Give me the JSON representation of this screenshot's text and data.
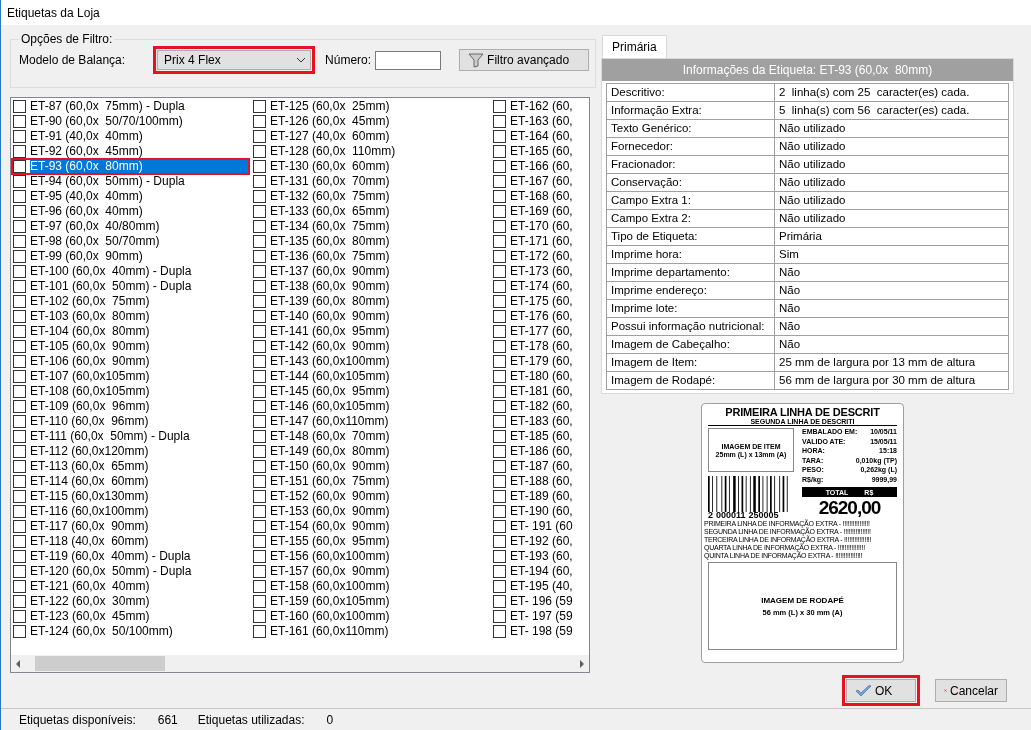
{
  "window": {
    "title": "Etiquetas da Loja"
  },
  "filter": {
    "legend": "Opções de Filtro:",
    "model_label": "Modelo de Balança:",
    "model_value": "Prix 4 Flex",
    "model_highlighted": true,
    "number_label": "Número:",
    "advanced_button": "Filtro avançado"
  },
  "label_list": {
    "highlight_selected": true,
    "columns": [
      {
        "items": [
          {
            "text": "ET-87 (60,0x  75mm) - Dupla",
            "checked": false,
            "selected": false
          },
          {
            "text": "ET-90 (60,0x  50/70/100mm)",
            "checked": false,
            "selected": false
          },
          {
            "text": "ET-91 (40,0x  40mm)",
            "checked": false,
            "selected": false
          },
          {
            "text": "ET-92 (60,0x  45mm)",
            "checked": false,
            "selected": false
          },
          {
            "text": "ET-93 (60,0x  80mm)",
            "checked": false,
            "selected": true
          },
          {
            "text": "ET-94 (60,0x  50mm) - Dupla",
            "checked": false,
            "selected": false
          },
          {
            "text": "ET-95 (40,0x  40mm)",
            "checked": false,
            "selected": false
          },
          {
            "text": "ET-96 (60,0x  40mm)",
            "checked": false,
            "selected": false
          },
          {
            "text": "ET-97 (60,0x  40/80mm)",
            "checked": false,
            "selected": false
          },
          {
            "text": "ET-98 (60,0x  50/70mm)",
            "checked": false,
            "selected": false
          },
          {
            "text": "ET-99 (60,0x  90mm)",
            "checked": false,
            "selected": false
          },
          {
            "text": "ET-100 (60,0x  40mm) - Dupla",
            "checked": false,
            "selected": false
          },
          {
            "text": "ET-101 (60,0x  50mm) - Dupla",
            "checked": false,
            "selected": false
          },
          {
            "text": "ET-102 (60,0x  75mm)",
            "checked": false,
            "selected": false
          },
          {
            "text": "ET-103 (60,0x  80mm)",
            "checked": false,
            "selected": false
          },
          {
            "text": "ET-104 (60,0x  80mm)",
            "checked": false,
            "selected": false
          },
          {
            "text": "ET-105 (60,0x  90mm)",
            "checked": false,
            "selected": false
          },
          {
            "text": "ET-106 (60,0x  90mm)",
            "checked": false,
            "selected": false
          },
          {
            "text": "ET-107 (60,0x105mm)",
            "checked": false,
            "selected": false
          },
          {
            "text": "ET-108 (60,0x105mm)",
            "checked": false,
            "selected": false
          },
          {
            "text": "ET-109 (60,0x  96mm)",
            "checked": false,
            "selected": false
          },
          {
            "text": "ET-110 (60,0x  96mm)",
            "checked": false,
            "selected": false
          },
          {
            "text": "ET-111 (60,0x  50mm) - Dupla",
            "checked": false,
            "selected": false
          },
          {
            "text": "ET-112 (60,0x120mm)",
            "checked": false,
            "selected": false
          },
          {
            "text": "ET-113 (60,0x  65mm)",
            "checked": false,
            "selected": false
          },
          {
            "text": "ET-114 (60,0x  60mm)",
            "checked": false,
            "selected": false
          },
          {
            "text": "ET-115 (60,0x130mm)",
            "checked": false,
            "selected": false
          },
          {
            "text": "ET-116 (60,0x100mm)",
            "checked": false,
            "selected": false
          },
          {
            "text": "ET-117 (60,0x  90mm)",
            "checked": false,
            "selected": false
          },
          {
            "text": "ET-118 (40,0x  60mm)",
            "checked": false,
            "selected": false
          },
          {
            "text": "ET-119 (60,0x  40mm) - Dupla",
            "checked": false,
            "selected": false
          },
          {
            "text": "ET-120 (60,0x  50mm) - Dupla",
            "checked": false,
            "selected": false
          },
          {
            "text": "ET-121 (60,0x  40mm)",
            "checked": false,
            "selected": false
          },
          {
            "text": "ET-122 (60,0x  30mm)",
            "checked": false,
            "selected": false
          },
          {
            "text": "ET-123 (60,0x  45mm)",
            "checked": false,
            "selected": false
          },
          {
            "text": "ET-124 (60,0x  50/100mm)",
            "checked": false,
            "selected": false
          }
        ]
      },
      {
        "items": [
          {
            "text": "ET-125 (60,0x  25mm)",
            "checked": false,
            "selected": false
          },
          {
            "text": "ET-126 (60,0x  45mm)",
            "checked": false,
            "selected": false
          },
          {
            "text": "ET-127 (40,0x  60mm)",
            "checked": false,
            "selected": false
          },
          {
            "text": "ET-128 (60,0x  110mm)",
            "checked": false,
            "selected": false
          },
          {
            "text": "ET-130 (60,0x  60mm)",
            "checked": false,
            "selected": false
          },
          {
            "text": "ET-131 (60,0x  70mm)",
            "checked": false,
            "selected": false
          },
          {
            "text": "ET-132 (60,0x  75mm)",
            "checked": false,
            "selected": false
          },
          {
            "text": "ET-133 (60,0x  65mm)",
            "checked": false,
            "selected": false
          },
          {
            "text": "ET-134 (60,0x  75mm)",
            "checked": false,
            "selected": false
          },
          {
            "text": "ET-135 (60,0x  80mm)",
            "checked": false,
            "selected": false
          },
          {
            "text": "ET-136 (60,0x  75mm)",
            "checked": false,
            "selected": false
          },
          {
            "text": "ET-137 (60,0x  90mm)",
            "checked": false,
            "selected": false
          },
          {
            "text": "ET-138 (60,0x  90mm)",
            "checked": false,
            "selected": false
          },
          {
            "text": "ET-139 (60,0x  80mm)",
            "checked": false,
            "selected": false
          },
          {
            "text": "ET-140 (60,0x  90mm)",
            "checked": false,
            "selected": false
          },
          {
            "text": "ET-141 (60,0x  95mm)",
            "checked": false,
            "selected": false
          },
          {
            "text": "ET-142 (60,0x  90mm)",
            "checked": false,
            "selected": false
          },
          {
            "text": "ET-143 (60,0x100mm)",
            "checked": false,
            "selected": false
          },
          {
            "text": "ET-144 (60,0x105mm)",
            "checked": false,
            "selected": false
          },
          {
            "text": "ET-145 (60,0x  95mm)",
            "checked": false,
            "selected": false
          },
          {
            "text": "ET-146 (60,0x105mm)",
            "checked": false,
            "selected": false
          },
          {
            "text": "ET-147 (60,0x110mm)",
            "checked": false,
            "selected": false
          },
          {
            "text": "ET-148 (60,0x  70mm)",
            "checked": false,
            "selected": false
          },
          {
            "text": "ET-149 (60,0x  80mm)",
            "checked": false,
            "selected": false
          },
          {
            "text": "ET-150 (60,0x  90mm)",
            "checked": false,
            "selected": false
          },
          {
            "text": "ET-151 (60,0x  75mm)",
            "checked": false,
            "selected": false
          },
          {
            "text": "ET-152 (60,0x  90mm)",
            "checked": false,
            "selected": false
          },
          {
            "text": "ET-153 (60,0x  90mm)",
            "checked": false,
            "selected": false
          },
          {
            "text": "ET-154 (60,0x  90mm)",
            "checked": false,
            "selected": false
          },
          {
            "text": "ET-155 (60,0x  95mm)",
            "checked": false,
            "selected": false
          },
          {
            "text": "ET-156 (60,0x100mm)",
            "checked": false,
            "selected": false
          },
          {
            "text": "ET-157 (60,0x  90mm)",
            "checked": false,
            "selected": false
          },
          {
            "text": "ET-158 (60,0x100mm)",
            "checked": false,
            "selected": false
          },
          {
            "text": "ET-159 (60,0x105mm)",
            "checked": false,
            "selected": false
          },
          {
            "text": "ET-160 (60,0x100mm)",
            "checked": false,
            "selected": false
          },
          {
            "text": "ET-161 (60,0x110mm)",
            "checked": false,
            "selected": false
          }
        ]
      },
      {
        "items": [
          {
            "text": "ET-162 (60,",
            "checked": false,
            "selected": false
          },
          {
            "text": "ET-163 (60,",
            "checked": false,
            "selected": false
          },
          {
            "text": "ET-164 (60,",
            "checked": false,
            "selected": false
          },
          {
            "text": "ET-165 (60,",
            "checked": false,
            "selected": false
          },
          {
            "text": "ET-166 (60,",
            "checked": false,
            "selected": false
          },
          {
            "text": "ET-167 (60,",
            "checked": false,
            "selected": false
          },
          {
            "text": "ET-168 (60,",
            "checked": false,
            "selected": false
          },
          {
            "text": "ET-169 (60,",
            "checked": false,
            "selected": false
          },
          {
            "text": "ET-170 (60,",
            "checked": false,
            "selected": false
          },
          {
            "text": "ET-171 (60,",
            "checked": false,
            "selected": false
          },
          {
            "text": "ET-172 (60,",
            "checked": false,
            "selected": false
          },
          {
            "text": "ET-173 (60,",
            "checked": false,
            "selected": false
          },
          {
            "text": "ET-174 (60,",
            "checked": false,
            "selected": false
          },
          {
            "text": "ET-175 (60,",
            "checked": false,
            "selected": false
          },
          {
            "text": "ET-176 (60,",
            "checked": false,
            "selected": false
          },
          {
            "text": "ET-177 (60,",
            "checked": false,
            "selected": false
          },
          {
            "text": "ET-178 (60,",
            "checked": false,
            "selected": false
          },
          {
            "text": "ET-179 (60,",
            "checked": false,
            "selected": false
          },
          {
            "text": "ET-180 (60,",
            "checked": false,
            "selected": false
          },
          {
            "text": "ET-181 (60,",
            "checked": false,
            "selected": false
          },
          {
            "text": "ET-182 (60,",
            "checked": false,
            "selected": false
          },
          {
            "text": "ET-183 (60,",
            "checked": false,
            "selected": false
          },
          {
            "text": "ET-185 (60,",
            "checked": false,
            "selected": false
          },
          {
            "text": "ET-186 (60,",
            "checked": false,
            "selected": false
          },
          {
            "text": "ET-187 (60,",
            "checked": false,
            "selected": false
          },
          {
            "text": "ET-188 (60,",
            "checked": false,
            "selected": false
          },
          {
            "text": "ET-189 (60,",
            "checked": false,
            "selected": false
          },
          {
            "text": "ET-190 (60,",
            "checked": false,
            "selected": false
          },
          {
            "text": "ET- 191 (60",
            "checked": false,
            "selected": false
          },
          {
            "text": "ET-192 (60,",
            "checked": false,
            "selected": false
          },
          {
            "text": "ET-193 (60,",
            "checked": false,
            "selected": false
          },
          {
            "text": "ET-194 (60,",
            "checked": false,
            "selected": false
          },
          {
            "text": "ET-195 (40,",
            "checked": false,
            "selected": false
          },
          {
            "text": "ET- 196 (59",
            "checked": false,
            "selected": false
          },
          {
            "text": "ET- 197 (59",
            "checked": false,
            "selected": false
          },
          {
            "text": "ET- 198 (59",
            "checked": false,
            "selected": false
          }
        ]
      }
    ]
  },
  "tabs": [
    {
      "label": "Primária",
      "selected": true
    }
  ],
  "info": {
    "header": "Informações da Etiqueta: ET-93 (60,0x  80mm)",
    "rows": [
      {
        "label": "Descritivo:",
        "value": "2  linha(s) com 25  caracter(es) cada."
      },
      {
        "label": "Informação Extra:",
        "value": "5  linha(s) com 56  caracter(es) cada."
      },
      {
        "label": "Texto Genérico:",
        "value": "Não utilizado"
      },
      {
        "label": "Fornecedor:",
        "value": "Não utilizado"
      },
      {
        "label": "Fracionador:",
        "value": "Não utilizado"
      },
      {
        "label": "Conservação:",
        "value": "Não utilizado"
      },
      {
        "label": "Campo Extra 1:",
        "value": "Não utilizado"
      },
      {
        "label": "Campo Extra 2:",
        "value": "Não utilizado"
      },
      {
        "label": "Tipo de Etiqueta:",
        "value": "Primária"
      },
      {
        "label": "Imprime hora:",
        "value": "Sim"
      },
      {
        "label": "Imprime departamento:",
        "value": "Não"
      },
      {
        "label": "Imprime endereço:",
        "value": "Não"
      },
      {
        "label": "Imprime lote:",
        "value": "Não"
      },
      {
        "label": "Possui informação nutricional:",
        "value": "Não"
      },
      {
        "label": "Imagem de Cabeçalho:",
        "value": "Não"
      },
      {
        "label": "Imagem de Item:",
        "value": "25 mm de largura por 13 mm de altura"
      },
      {
        "label": "Imagem de Rodapé:",
        "value": "56 mm de largura por 30 mm de altura"
      }
    ]
  },
  "preview": {
    "title": "PRIMEIRA LINHA DE DESCRIT",
    "subtitle": "SEGUNDA LINHA DE DESCRITI",
    "item_image": {
      "title": "IMAGEM DE ITEM",
      "size": "25mm (L) x 13mm (A)"
    },
    "fields": [
      {
        "label": "EMBALADO EM:",
        "value": "10/05/11"
      },
      {
        "label": "VALIDO ATE:",
        "value": "15/05/11"
      },
      {
        "label": "HORA:",
        "value": "15:18"
      },
      {
        "label": "TARA:",
        "value": "0,010kg (TP)"
      },
      {
        "label": "PESO:",
        "value": "0,262kg (L)"
      },
      {
        "label": "R$/kg:",
        "value": "9999,99"
      }
    ],
    "total_label": "TOTAL",
    "total_currency": "R$",
    "total": "2620,00",
    "barcode_digits": [
      "2",
      "000011",
      "250005"
    ],
    "extra_lines": [
      "PRIMEIRA LINHA DE INFORMAÇÃO EXTRA - !!!!!!!!!!!!!!!!",
      "SEGUNDA LINHA DE INFORMAÇÃO EXTRA - !!!!!!!!!!!!!!!!",
      "TERCEIRA LINHA DE INFORMAÇÃO EXTRA - !!!!!!!!!!!!!!!!",
      "QUARTA LINHA DE INFORMAÇÃO EXTRA - !!!!!!!!!!!!!!!!",
      "QUINTA LINHA DE INFORMAÇÃO EXTRA - !!!!!!!!!!!!!!!!"
    ],
    "footer_image": {
      "title": "IMAGEM DE RODAPÉ",
      "size": "56 mm (L) x 30 mm (A)"
    }
  },
  "buttons": [
    {
      "kind": "ok",
      "label": "OK",
      "highlighted": true
    },
    {
      "kind": "cancel",
      "label": "Cancelar",
      "highlighted": false
    }
  ],
  "status_bar": [
    {
      "label": "Etiquetas disponíveis:",
      "value": "661"
    },
    {
      "label": "Etiquetas utilizadas:",
      "value": "0"
    }
  ]
}
